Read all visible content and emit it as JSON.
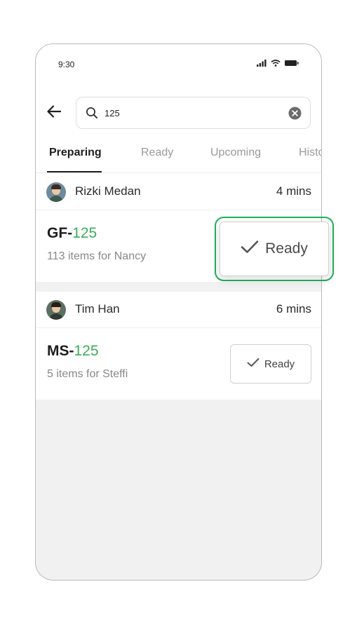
{
  "status_bar": {
    "time": "9:30",
    "icons": [
      "signal-icon",
      "wifi-icon",
      "battery-icon"
    ]
  },
  "search": {
    "value": "125",
    "icons": {
      "back": "arrow-left-icon",
      "search": "search-icon",
      "clear": "clear-icon"
    }
  },
  "tabs": [
    {
      "label": "Preparing",
      "active": true
    },
    {
      "label": "Ready",
      "active": false
    },
    {
      "label": "Upcoming",
      "active": false
    },
    {
      "label": "Histo",
      "active": false
    }
  ],
  "orders": [
    {
      "customer": "Rizki Medan",
      "elapsed": "4 mins",
      "id_prefix": "GF-",
      "id_number": "125",
      "summary": "113 items for Nancy",
      "action_label": "Ready"
    },
    {
      "customer": "Tim Han",
      "elapsed": "6 mins",
      "id_prefix": "MS-",
      "id_number": "125",
      "summary": "5 items for Steffi",
      "action_label": "Ready"
    }
  ],
  "colors": {
    "accent_green": "#3cac5a",
    "highlight_border": "#1fb25a",
    "background": "#f1f1f1"
  }
}
